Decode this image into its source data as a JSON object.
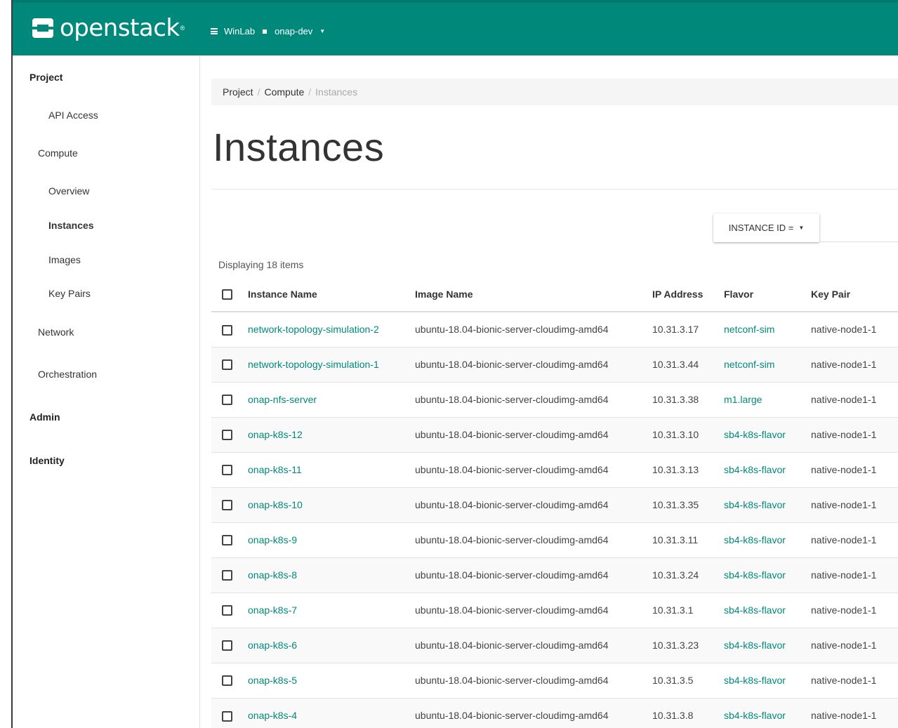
{
  "brand": {
    "name": "openstack",
    "reg_mark": "®"
  },
  "context": {
    "domain": "WinLab",
    "project": "onap-dev"
  },
  "sidebar": {
    "project": "Project",
    "api_access": "API Access",
    "compute": "Compute",
    "overview": "Overview",
    "instances": "Instances",
    "images": "Images",
    "key_pairs": "Key Pairs",
    "network": "Network",
    "orchestration": "Orchestration",
    "admin": "Admin",
    "identity": "Identity"
  },
  "breadcrumb": {
    "project": "Project",
    "compute": "Compute",
    "instances": "Instances",
    "separator": "/"
  },
  "page": {
    "title": "Instances"
  },
  "filter": {
    "label": "INSTANCE ID ="
  },
  "table": {
    "count_text": "Displaying 18 items",
    "headers": {
      "name": "Instance Name",
      "image": "Image Name",
      "ip": "IP Address",
      "flavor": "Flavor",
      "keypair": "Key Pair"
    },
    "rows": [
      {
        "name": "network-topology-simulation-2",
        "image": "ubuntu-18.04-bionic-server-cloudimg-amd64",
        "ip": "10.31.3.17",
        "flavor": "netconf-sim",
        "keypair": "native-node1-1"
      },
      {
        "name": "network-topology-simulation-1",
        "image": "ubuntu-18.04-bionic-server-cloudimg-amd64",
        "ip": "10.31.3.44",
        "flavor": "netconf-sim",
        "keypair": "native-node1-1"
      },
      {
        "name": "onap-nfs-server",
        "image": "ubuntu-18.04-bionic-server-cloudimg-amd64",
        "ip": "10.31.3.38",
        "flavor": "m1.large",
        "keypair": "native-node1-1"
      },
      {
        "name": "onap-k8s-12",
        "image": "ubuntu-18.04-bionic-server-cloudimg-amd64",
        "ip": "10.31.3.10",
        "flavor": "sb4-k8s-flavor",
        "keypair": "native-node1-1"
      },
      {
        "name": "onap-k8s-11",
        "image": "ubuntu-18.04-bionic-server-cloudimg-amd64",
        "ip": "10.31.3.13",
        "flavor": "sb4-k8s-flavor",
        "keypair": "native-node1-1"
      },
      {
        "name": "onap-k8s-10",
        "image": "ubuntu-18.04-bionic-server-cloudimg-amd64",
        "ip": "10.31.3.35",
        "flavor": "sb4-k8s-flavor",
        "keypair": "native-node1-1"
      },
      {
        "name": "onap-k8s-9",
        "image": "ubuntu-18.04-bionic-server-cloudimg-amd64",
        "ip": "10.31.3.11",
        "flavor": "sb4-k8s-flavor",
        "keypair": "native-node1-1"
      },
      {
        "name": "onap-k8s-8",
        "image": "ubuntu-18.04-bionic-server-cloudimg-amd64",
        "ip": "10.31.3.24",
        "flavor": "sb4-k8s-flavor",
        "keypair": "native-node1-1"
      },
      {
        "name": "onap-k8s-7",
        "image": "ubuntu-18.04-bionic-server-cloudimg-amd64",
        "ip": "10.31.3.1",
        "flavor": "sb4-k8s-flavor",
        "keypair": "native-node1-1"
      },
      {
        "name": "onap-k8s-6",
        "image": "ubuntu-18.04-bionic-server-cloudimg-amd64",
        "ip": "10.31.3.23",
        "flavor": "sb4-k8s-flavor",
        "keypair": "native-node1-1"
      },
      {
        "name": "onap-k8s-5",
        "image": "ubuntu-18.04-bionic-server-cloudimg-amd64",
        "ip": "10.31.3.5",
        "flavor": "sb4-k8s-flavor",
        "keypair": "native-node1-1"
      },
      {
        "name": "onap-k8s-4",
        "image": "ubuntu-18.04-bionic-server-cloudimg-amd64",
        "ip": "10.31.3.8",
        "flavor": "sb4-k8s-flavor",
        "keypair": "native-node1-1"
      }
    ]
  },
  "colors": {
    "brand": "#00897b",
    "link": "#00897b"
  },
  "icons": {
    "context_menu": "list-icon",
    "project_marker": "square-icon",
    "dropdown": "caret-down-icon",
    "row_select": "checkbox-icon"
  }
}
